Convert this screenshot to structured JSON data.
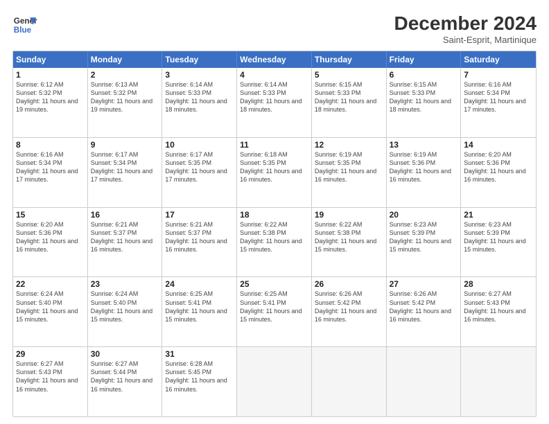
{
  "header": {
    "logo_line1": "General",
    "logo_line2": "Blue",
    "month_title": "December 2024",
    "location": "Saint-Esprit, Martinique"
  },
  "days_of_week": [
    "Sunday",
    "Monday",
    "Tuesday",
    "Wednesday",
    "Thursday",
    "Friday",
    "Saturday"
  ],
  "weeks": [
    [
      {
        "day": "1",
        "sunrise": "6:12 AM",
        "sunset": "5:32 PM",
        "daylight": "11 hours and 19 minutes."
      },
      {
        "day": "2",
        "sunrise": "6:13 AM",
        "sunset": "5:32 PM",
        "daylight": "11 hours and 19 minutes."
      },
      {
        "day": "3",
        "sunrise": "6:14 AM",
        "sunset": "5:33 PM",
        "daylight": "11 hours and 18 minutes."
      },
      {
        "day": "4",
        "sunrise": "6:14 AM",
        "sunset": "5:33 PM",
        "daylight": "11 hours and 18 minutes."
      },
      {
        "day": "5",
        "sunrise": "6:15 AM",
        "sunset": "5:33 PM",
        "daylight": "11 hours and 18 minutes."
      },
      {
        "day": "6",
        "sunrise": "6:15 AM",
        "sunset": "5:33 PM",
        "daylight": "11 hours and 18 minutes."
      },
      {
        "day": "7",
        "sunrise": "6:16 AM",
        "sunset": "5:34 PM",
        "daylight": "11 hours and 17 minutes."
      }
    ],
    [
      {
        "day": "8",
        "sunrise": "6:16 AM",
        "sunset": "5:34 PM",
        "daylight": "11 hours and 17 minutes."
      },
      {
        "day": "9",
        "sunrise": "6:17 AM",
        "sunset": "5:34 PM",
        "daylight": "11 hours and 17 minutes."
      },
      {
        "day": "10",
        "sunrise": "6:17 AM",
        "sunset": "5:35 PM",
        "daylight": "11 hours and 17 minutes."
      },
      {
        "day": "11",
        "sunrise": "6:18 AM",
        "sunset": "5:35 PM",
        "daylight": "11 hours and 16 minutes."
      },
      {
        "day": "12",
        "sunrise": "6:19 AM",
        "sunset": "5:35 PM",
        "daylight": "11 hours and 16 minutes."
      },
      {
        "day": "13",
        "sunrise": "6:19 AM",
        "sunset": "5:36 PM",
        "daylight": "11 hours and 16 minutes."
      },
      {
        "day": "14",
        "sunrise": "6:20 AM",
        "sunset": "5:36 PM",
        "daylight": "11 hours and 16 minutes."
      }
    ],
    [
      {
        "day": "15",
        "sunrise": "6:20 AM",
        "sunset": "5:36 PM",
        "daylight": "11 hours and 16 minutes."
      },
      {
        "day": "16",
        "sunrise": "6:21 AM",
        "sunset": "5:37 PM",
        "daylight": "11 hours and 16 minutes."
      },
      {
        "day": "17",
        "sunrise": "6:21 AM",
        "sunset": "5:37 PM",
        "daylight": "11 hours and 16 minutes."
      },
      {
        "day": "18",
        "sunrise": "6:22 AM",
        "sunset": "5:38 PM",
        "daylight": "11 hours and 15 minutes."
      },
      {
        "day": "19",
        "sunrise": "6:22 AM",
        "sunset": "5:38 PM",
        "daylight": "11 hours and 15 minutes."
      },
      {
        "day": "20",
        "sunrise": "6:23 AM",
        "sunset": "5:39 PM",
        "daylight": "11 hours and 15 minutes."
      },
      {
        "day": "21",
        "sunrise": "6:23 AM",
        "sunset": "5:39 PM",
        "daylight": "11 hours and 15 minutes."
      }
    ],
    [
      {
        "day": "22",
        "sunrise": "6:24 AM",
        "sunset": "5:40 PM",
        "daylight": "11 hours and 15 minutes."
      },
      {
        "day": "23",
        "sunrise": "6:24 AM",
        "sunset": "5:40 PM",
        "daylight": "11 hours and 15 minutes."
      },
      {
        "day": "24",
        "sunrise": "6:25 AM",
        "sunset": "5:41 PM",
        "daylight": "11 hours and 15 minutes."
      },
      {
        "day": "25",
        "sunrise": "6:25 AM",
        "sunset": "5:41 PM",
        "daylight": "11 hours and 15 minutes."
      },
      {
        "day": "26",
        "sunrise": "6:26 AM",
        "sunset": "5:42 PM",
        "daylight": "11 hours and 16 minutes."
      },
      {
        "day": "27",
        "sunrise": "6:26 AM",
        "sunset": "5:42 PM",
        "daylight": "11 hours and 16 minutes."
      },
      {
        "day": "28",
        "sunrise": "6:27 AM",
        "sunset": "5:43 PM",
        "daylight": "11 hours and 16 minutes."
      }
    ],
    [
      {
        "day": "29",
        "sunrise": "6:27 AM",
        "sunset": "5:43 PM",
        "daylight": "11 hours and 16 minutes."
      },
      {
        "day": "30",
        "sunrise": "6:27 AM",
        "sunset": "5:44 PM",
        "daylight": "11 hours and 16 minutes."
      },
      {
        "day": "31",
        "sunrise": "6:28 AM",
        "sunset": "5:45 PM",
        "daylight": "11 hours and 16 minutes."
      },
      null,
      null,
      null,
      null
    ]
  ]
}
